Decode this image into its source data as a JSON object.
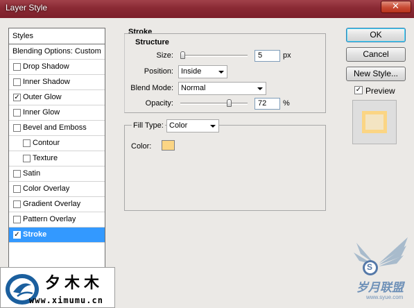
{
  "window": {
    "title": "Layer Style",
    "close_glyph": "✕"
  },
  "styles_panel": {
    "header": "Styles",
    "items": [
      {
        "label": "Blending Options: Custom",
        "has_checkbox": false,
        "checked": false,
        "indent": false,
        "selected": false
      },
      {
        "label": "Drop Shadow",
        "has_checkbox": true,
        "checked": false,
        "indent": false,
        "selected": false
      },
      {
        "label": "Inner Shadow",
        "has_checkbox": true,
        "checked": false,
        "indent": false,
        "selected": false
      },
      {
        "label": "Outer Glow",
        "has_checkbox": true,
        "checked": true,
        "indent": false,
        "selected": false
      },
      {
        "label": "Inner Glow",
        "has_checkbox": true,
        "checked": false,
        "indent": false,
        "selected": false
      },
      {
        "label": "Bevel and Emboss",
        "has_checkbox": true,
        "checked": false,
        "indent": false,
        "selected": false
      },
      {
        "label": "Contour",
        "has_checkbox": true,
        "checked": false,
        "indent": true,
        "selected": false
      },
      {
        "label": "Texture",
        "has_checkbox": true,
        "checked": false,
        "indent": true,
        "selected": false
      },
      {
        "label": "Satin",
        "has_checkbox": true,
        "checked": false,
        "indent": false,
        "selected": false
      },
      {
        "label": "Color Overlay",
        "has_checkbox": true,
        "checked": false,
        "indent": false,
        "selected": false
      },
      {
        "label": "Gradient Overlay",
        "has_checkbox": true,
        "checked": false,
        "indent": false,
        "selected": false
      },
      {
        "label": "Pattern Overlay",
        "has_checkbox": true,
        "checked": false,
        "indent": false,
        "selected": false
      },
      {
        "label": "Stroke",
        "has_checkbox": true,
        "checked": true,
        "indent": false,
        "selected": true
      }
    ],
    "check_glyph": "✓"
  },
  "stroke": {
    "section_title": "Stroke",
    "structure_title": "Structure",
    "size_label": "Size:",
    "size_value": "5",
    "size_unit": "px",
    "size_fraction": 0.03,
    "position_label": "Position:",
    "position_value": "Inside",
    "blend_mode_label": "Blend Mode:",
    "blend_mode_value": "Normal",
    "opacity_label": "Opacity:",
    "opacity_value": "72",
    "opacity_unit": "%",
    "opacity_fraction": 0.72,
    "fill_type_label": "Fill Type:",
    "fill_type_value": "Color",
    "color_label": "Color:",
    "color_swatch": "#fbd584"
  },
  "buttons": {
    "ok": "OK",
    "cancel": "Cancel",
    "new_style": "New Style..."
  },
  "preview": {
    "label": "Preview",
    "checked": true,
    "swatch_color": "#fbd584",
    "inner_color": "#f3e4c2"
  },
  "footer_logo": {
    "brand_text": "夕木木",
    "url_text": "www.ximumu.cn"
  },
  "watermark": {
    "text": "岁月联盟",
    "url_text": "www.syue.com",
    "letter": "S"
  }
}
